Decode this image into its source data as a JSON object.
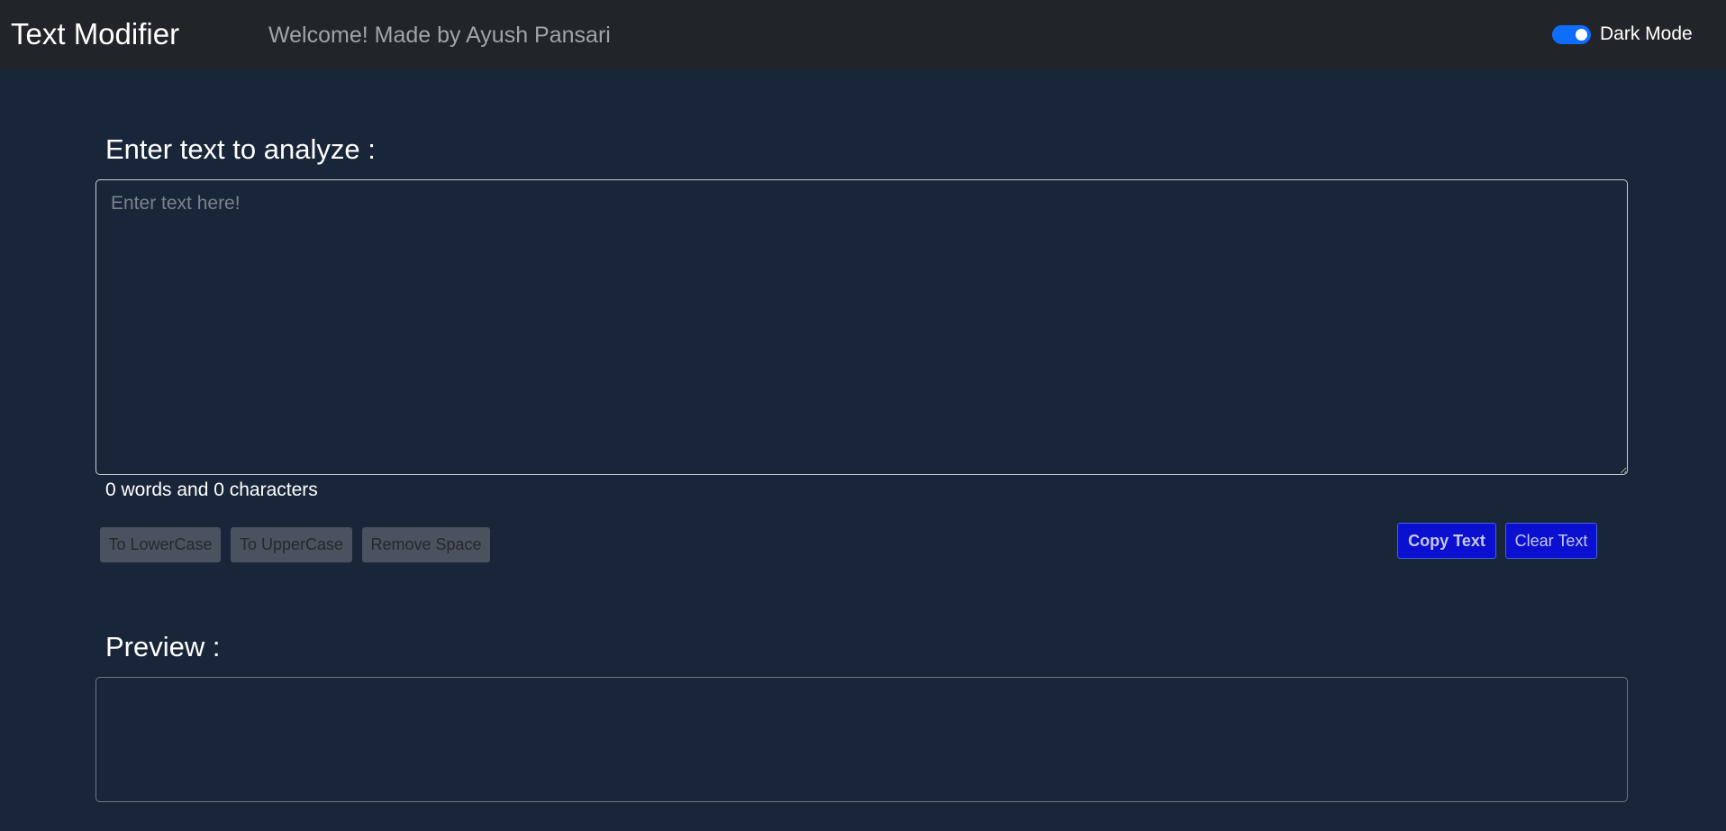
{
  "navbar": {
    "brand": "Text Modifier",
    "welcome": "Welcome! Made by Ayush Pansari",
    "dark_mode_label": "Dark Mode",
    "dark_mode_enabled": true
  },
  "editor": {
    "heading": "Enter text to analyze :",
    "placeholder": "Enter text here!",
    "value": "",
    "summary": "0 words and 0 characters"
  },
  "actions": {
    "lowercase_label": "To LowerCase",
    "uppercase_label": "To UpperCase",
    "remove_space_label": "Remove Space",
    "copy_label": "Copy Text",
    "clear_label": "Clear Text"
  },
  "preview": {
    "heading": "Preview :",
    "content": ""
  },
  "colors": {
    "page_background": "#19263a",
    "navbar_background": "#212529",
    "switch_on": "#0d6efd",
    "primary_button": "#0b0fd0",
    "secondary_button": "#4a5260"
  }
}
